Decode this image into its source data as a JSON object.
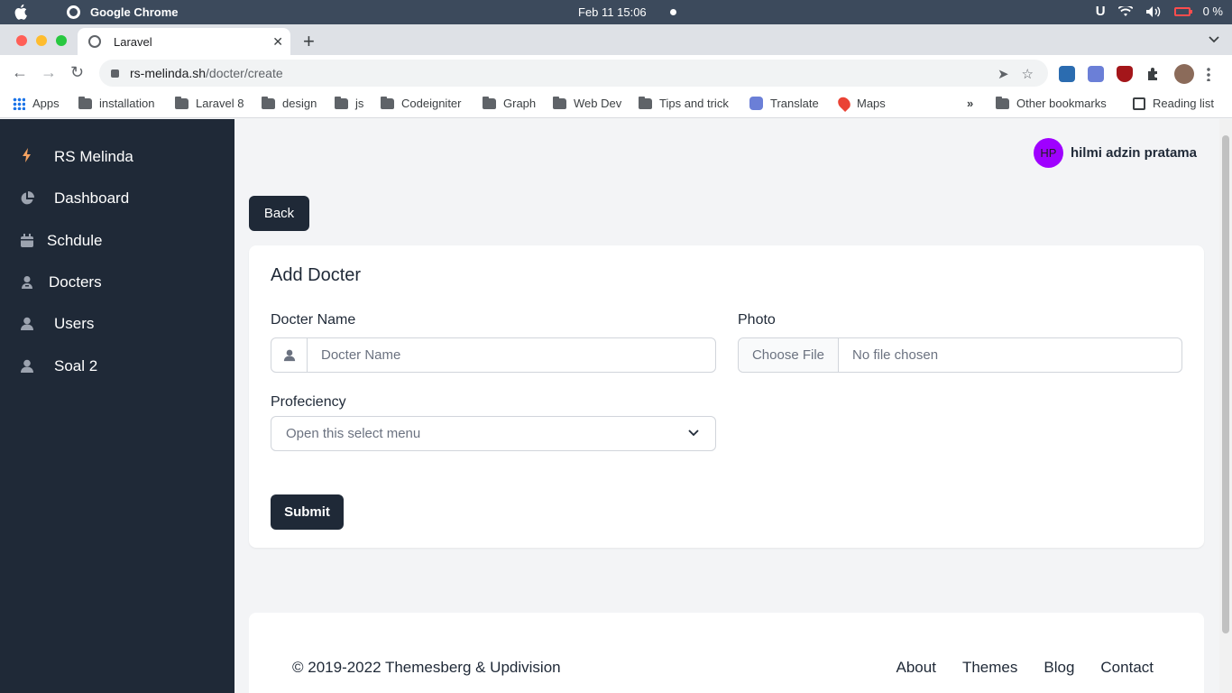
{
  "os": {
    "app_name": "Google Chrome",
    "clock": "Feb 11  15:06",
    "battery": "0 %"
  },
  "browser": {
    "tab_title": "Laravel",
    "url_host": "rs-melinda.sh",
    "url_path": "/docter/create",
    "bookmarks": [
      "Apps",
      "installation",
      "Laravel 8",
      "design",
      "js",
      "Codeigniter",
      "Graph",
      "Web Dev",
      "Tips and trick",
      "Translate",
      "Maps"
    ],
    "other_bookmarks": "Other bookmarks",
    "reading_list": "Reading list",
    "more": "»"
  },
  "sidebar": {
    "brand": "RS Melinda",
    "items": [
      {
        "label": "Dashboard",
        "icon": "pie-chart-icon"
      },
      {
        "label": "Schdule",
        "icon": "calendar-icon"
      },
      {
        "label": "Docters",
        "icon": "doctor-icon"
      },
      {
        "label": "Users",
        "icon": "user-icon"
      },
      {
        "label": "Soal 2",
        "icon": "user-icon"
      }
    ]
  },
  "header": {
    "user_initials": "HP",
    "user_name": "hilmi adzin pratama"
  },
  "page": {
    "back_label": "Back",
    "title": "Add Docter",
    "name_label": "Docter Name",
    "name_placeholder": "Docter Name",
    "photo_label": "Photo",
    "choose_file": "Choose File",
    "no_file": "No file chosen",
    "proficiency_label": "Profeciency",
    "select_placeholder": "Open this select menu",
    "submit_label": "Submit"
  },
  "footer": {
    "copyright": "© 2019-2022 Themesberg & Updivision",
    "links": [
      "About",
      "Themes",
      "Blog",
      "Contact"
    ]
  },
  "colors": {
    "sidebar_bg": "#1f2937",
    "page_bg": "#f3f4f6",
    "accent_dark": "#1f2937",
    "avatar": "#9f00ff"
  }
}
